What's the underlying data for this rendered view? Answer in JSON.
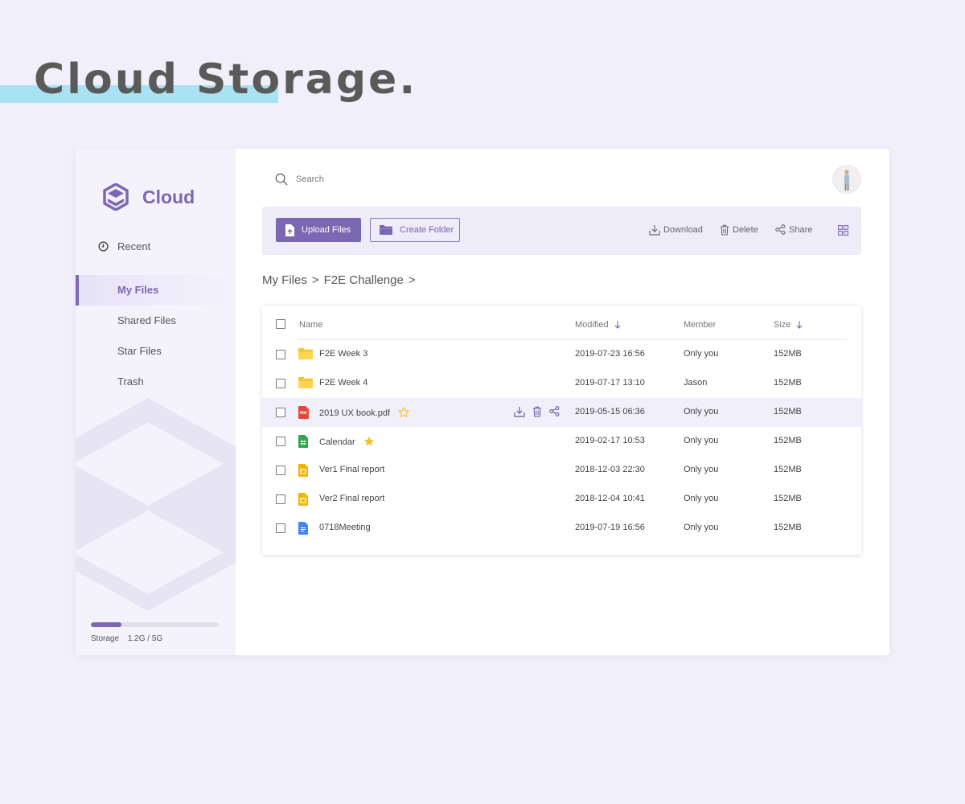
{
  "hero": {
    "title": "Cloud Storage."
  },
  "app": {
    "name": "Cloud"
  },
  "sidebar": {
    "recent_label": "Recent",
    "items": [
      {
        "label": "My Files",
        "active": true
      },
      {
        "label": "Shared Files"
      },
      {
        "label": "Star Files"
      },
      {
        "label": "Trash"
      }
    ],
    "storage": {
      "label": "Storage",
      "value": "1.2G / 5G",
      "used_fraction": 0.24
    }
  },
  "search": {
    "placeholder": "Search"
  },
  "toolbar": {
    "upload_label": "Upload Files",
    "create_folder_label": "Create Folder",
    "download_label": "Download",
    "delete_label": "Delete",
    "share_label": "Share"
  },
  "breadcrumb": [
    "My Files",
    ">",
    "F2E Challenge",
    ">"
  ],
  "table": {
    "columns": {
      "name": "Name",
      "modified": "Modified",
      "member": "Member",
      "size": "Size"
    },
    "rows": [
      {
        "name": "F2E Week 3",
        "type": "folder-icon",
        "modified": "2019-07-23 16:56",
        "member": "Only you",
        "size": "152MB"
      },
      {
        "name": "F2E Week 4",
        "type": "folder-icon",
        "modified": "2019-07-17 13:10",
        "member": "Jason",
        "size": "152MB"
      },
      {
        "name": "2019 UX book.pdf",
        "type": "pdf-file-icon",
        "starred": "outline",
        "hovered": true,
        "modified": "2019-05-15 06:36",
        "member": "Only you",
        "size": "152MB"
      },
      {
        "name": "Calendar",
        "type": "sheets-file-icon",
        "starred": "filled",
        "modified": "2019-02-17 10:53",
        "member": "Only you",
        "size": "152MB"
      },
      {
        "name": "Ver1 Final report",
        "type": "slides-file-icon",
        "modified": "2018-12-03 22:30",
        "member": "Only you",
        "size": "152MB"
      },
      {
        "name": "Ver2 Final report",
        "type": "slides-file-icon",
        "modified": "2018-12-04 10:41",
        "member": "Only you",
        "size": "152MB"
      },
      {
        "name": "0718Meeting",
        "type": "docs-file-icon",
        "modified": "2019-07-19 16:56",
        "member": "Only you",
        "size": "152MB"
      }
    ]
  },
  "colors": {
    "page_bg": "#f1eff9",
    "accent": "#7b67b2",
    "hero_highlight": "#a9e2f3",
    "folder": "#f5c232",
    "pdf": "#e8463c",
    "sheets": "#2fa84f",
    "slides": "#f5b400",
    "docs": "#4285f4",
    "star": "#f5c232"
  }
}
